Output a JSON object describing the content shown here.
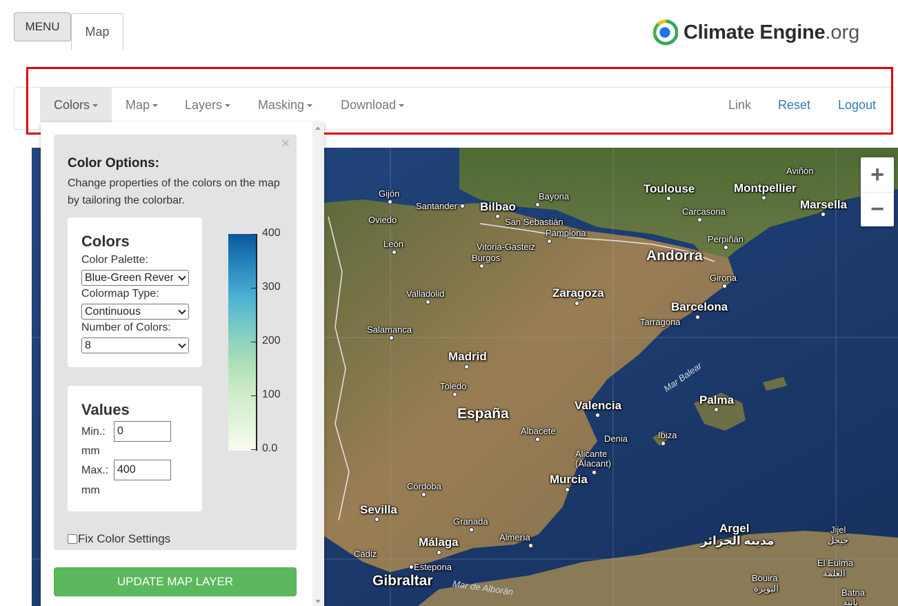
{
  "top": {
    "menu_label": "MENU",
    "map_tab_label": "Map"
  },
  "logo": {
    "name": "Climate Engine",
    "tld": ".org"
  },
  "navbar": {
    "items": [
      {
        "label": "Colors"
      },
      {
        "label": "Map"
      },
      {
        "label": "Layers"
      },
      {
        "label": "Masking"
      },
      {
        "label": "Download"
      }
    ],
    "right": [
      {
        "label": "Link"
      },
      {
        "label": "Reset"
      },
      {
        "label": "Logout"
      }
    ],
    "colors": {
      "inactive_link": "#777777",
      "blue_link": "#337ab7",
      "highlight_box": "#e00000"
    }
  },
  "panel": {
    "close_label": "×",
    "title": "Color Options:",
    "description": "Change properties of the colors on the map by tailoring the colorbar.",
    "colors_card": {
      "heading": "Colors",
      "palette_label": "Color Palette:",
      "palette_value": "Blue-Green Reverse",
      "colormap_label": "Colormap Type:",
      "colormap_value": "Continuous",
      "ncolors_label": "Number of Colors:",
      "ncolors_value": "8"
    },
    "colorbar_ticks": [
      "400",
      "300",
      "200",
      "100",
      "0.0"
    ],
    "values_card": {
      "heading": "Values",
      "min_label": "Min.:",
      "min_value": "0",
      "min_unit": "mm",
      "max_label": "Max.:",
      "max_value": "400",
      "max_unit": "mm"
    },
    "fix_label": "Fix Color Settings",
    "update_button": "UPDATE MAP LAYER",
    "colors": {
      "update_button_bg": "#5cb85c"
    }
  },
  "map": {
    "zoom_in": "+",
    "zoom_out": "−",
    "labels": {
      "avinon": "Aviñón",
      "toulouse": "Toulouse",
      "montpellier": "Montpellier",
      "marsella": "Marsella",
      "gijon": "Gijón",
      "santander": "Santander",
      "bilbao": "Bilbao",
      "bayona": "Bayona",
      "carcasona": "Carcasona",
      "oviedo": "Oviedo",
      "san_sebastian": "San Sebastián",
      "pamplona": "Pamplona",
      "perpinan": "Perpiñán",
      "leon": "León",
      "vitoria": "Vitoria-Gasteiz",
      "andorra": "Andorra",
      "burgos": "Burgos",
      "girona": "Girona",
      "valladolid": "Valladolid",
      "zaragoza": "Zaragoza",
      "barcelona": "Barcelona",
      "tarragona": "Tarragona",
      "salamanca": "Salamanca",
      "madrid": "Madrid",
      "mar_balear": "Mar Balear",
      "toledo": "Toledo",
      "valencia": "Valencia",
      "palma": "Palma",
      "espana": "España",
      "albacete": "Albacete",
      "denia": "Denia",
      "ibiza": "Ibiza",
      "alicante": "Alicante (Alacant)",
      "murcia": "Murcia",
      "cordoba": "Córdoba",
      "sevilla": "Sevilla",
      "granada": "Granada",
      "argel": "Argel",
      "argel_ar": "مدينة الجزائر",
      "jijel": "Jijel",
      "jijel_ar": "جيجل",
      "malaga": "Málaga",
      "almeria": "Almería",
      "cadiz": "Cádiz",
      "el_eulma": "El Eulma",
      "el_eulma_ar": "العلمة",
      "estepona": "Estepona",
      "gibraltar": "Gibraltar",
      "mar_de_alboran": "Mar de Alborán",
      "bouira": "Bouira",
      "bouira_ar": "البويرة",
      "batna": "Batna",
      "batna_ar": "باتنة"
    }
  }
}
